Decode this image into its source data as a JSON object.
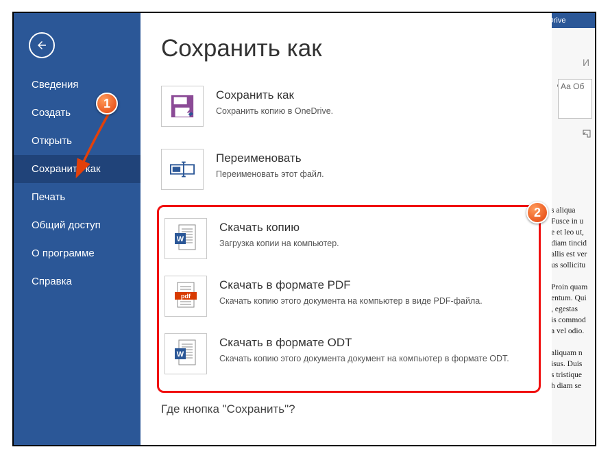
{
  "app": {
    "title_right": "OneDrive"
  },
  "sidebar": {
    "items": [
      {
        "label": "Сведения"
      },
      {
        "label": "Создать"
      },
      {
        "label": "Открыть"
      },
      {
        "label": "Сохранить как",
        "active": true
      },
      {
        "label": "Печать"
      },
      {
        "label": "Общий доступ"
      },
      {
        "label": "О программе"
      },
      {
        "label": "Справка"
      }
    ]
  },
  "page": {
    "title": "Сохранить как",
    "actions": [
      {
        "title": "Сохранить как",
        "desc": "Сохранить копию в OneDrive."
      },
      {
        "title": "Переименовать",
        "desc": "Переименовать этот файл."
      },
      {
        "title": "Скачать копию",
        "desc": "Загрузка копии на компьютер."
      },
      {
        "title": "Скачать в формате PDF",
        "desc": "Скачать копию этого документа на компьютер в виде PDF-файла."
      },
      {
        "title": "Скачать в формате ODT",
        "desc": "Скачать копию этого документа документ на компьютер в формате ODT."
      }
    ],
    "footer_label": "Где кнопка \"Сохранить\"?"
  },
  "preview": {
    "ribbon_tab": "И",
    "style_box": "Аа\nОб",
    "doc_text": "s aliqua\nFusce in u\ne et leo ut,\ndiam tincid\nallis est ver\nus sollicitu\n\nProin quam\nentum. Qui\n, egestas\nis commod\na vel odio.\n\naliquam n\nisus. Duis\ns tristique\nh diam se"
  },
  "annotations": {
    "b1": "1",
    "b2": "2"
  }
}
